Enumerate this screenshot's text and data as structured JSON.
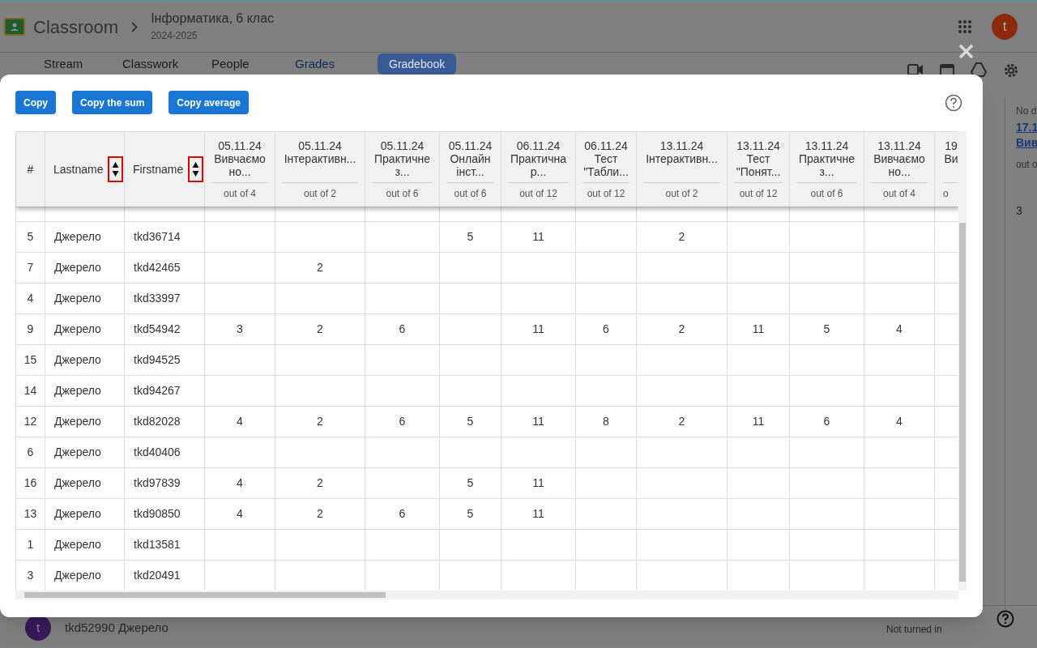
{
  "app_bar": {
    "app_name": "Classroom",
    "course": "Інформатика, 6 клас",
    "year": "2024-2025",
    "avatar": "t"
  },
  "class_tabs": [
    {
      "label": "Stream",
      "selected": false
    },
    {
      "label": "Classwork",
      "selected": false
    },
    {
      "label": "People",
      "selected": false
    },
    {
      "label": "Grades",
      "selected": true
    }
  ],
  "gradebook_button": "Gradebook",
  "side_column": {
    "header_note": "No d",
    "link": "17.1",
    "link_rest": "Вив",
    "out_of": "out o",
    "grade": "3"
  },
  "student_row": {
    "avatar": "t",
    "name": "tkd52990 Джерело",
    "status": "Not turned in"
  },
  "dialog": {
    "buttons": [
      "Copy",
      "Copy the sum",
      "Copy average"
    ],
    "table": {
      "columns": [
        "#",
        "Lastname",
        "Firstname"
      ],
      "assignments": [
        {
          "date": "05.11.24",
          "title": "Вивчаємо но...",
          "out_of": "out of 4"
        },
        {
          "date": "05.11.24",
          "title": "Інтерактивн...",
          "out_of": "out of 2"
        },
        {
          "date": "05.11.24",
          "title": "Практичне з...",
          "out_of": "out of 6"
        },
        {
          "date": "05.11.24",
          "title": "Онлайн інст...",
          "out_of": "out of 6"
        },
        {
          "date": "06.11.24",
          "title": "Практична р...",
          "out_of": "out of 12"
        },
        {
          "date": "06.11.24",
          "title": "Тест \"Табли...",
          "out_of": "out of 12"
        },
        {
          "date": "13.11.24",
          "title": "Інтерактивн...",
          "out_of": "out of 2"
        },
        {
          "date": "13.11.24",
          "title": "Тест \"Понят...",
          "out_of": "out of 12"
        },
        {
          "date": "13.11.24",
          "title": "Практичне з...",
          "out_of": "out of 6"
        },
        {
          "date": "13.11.24",
          "title": "Вивчаємо но...",
          "out_of": "out of 4"
        },
        {
          "date": "19",
          "title": "Ви",
          "out_of": "o"
        }
      ],
      "rows": [
        {
          "number": "5",
          "lastname": "Джерело",
          "firstname": "tkd36714",
          "grades": {
            "4": "5",
            "5": "11",
            "7": "2"
          }
        },
        {
          "number": "7",
          "lastname": "Джерело",
          "firstname": "tkd42465",
          "grades": {
            "2": "2"
          }
        },
        {
          "number": "4",
          "lastname": "Джерело",
          "firstname": "tkd33997"
        },
        {
          "number": "9",
          "lastname": "Джерело",
          "firstname": "tkd54942",
          "grades": {
            "1": "3",
            "2": "2",
            "3": "6",
            "5": "11",
            "6": "6",
            "7": "2",
            "8": "11",
            "9": "5",
            "10": "4"
          }
        },
        {
          "number": "15",
          "lastname": "Джерело",
          "firstname": "tkd94525"
        },
        {
          "number": "14",
          "lastname": "Джерело",
          "firstname": "tkd94267"
        },
        {
          "number": "12",
          "lastname": "Джерело",
          "firstname": "tkd82028",
          "grades": {
            "1": "4",
            "2": "2",
            "3": "6",
            "4": "5",
            "5": "11",
            "6": "8",
            "7": "2",
            "8": "11",
            "9": "6",
            "10": "4"
          }
        },
        {
          "number": "6",
          "lastname": "Джерело",
          "firstname": "tkd40406"
        },
        {
          "number": "16",
          "lastname": "Джерело",
          "firstname": "tkd97839",
          "grades": {
            "1": "4",
            "2": "2",
            "4": "5",
            "5": "11"
          }
        },
        {
          "number": "13",
          "lastname": "Джерело",
          "firstname": "tkd90850",
          "grades": {
            "1": "4",
            "2": "2",
            "3": "6",
            "4": "5",
            "5": "11"
          }
        },
        {
          "number": "1",
          "lastname": "Джерело",
          "firstname": "tkd13581"
        },
        {
          "number": "3",
          "lastname": "Джерело",
          "firstname": "tkd20491"
        }
      ]
    }
  }
}
